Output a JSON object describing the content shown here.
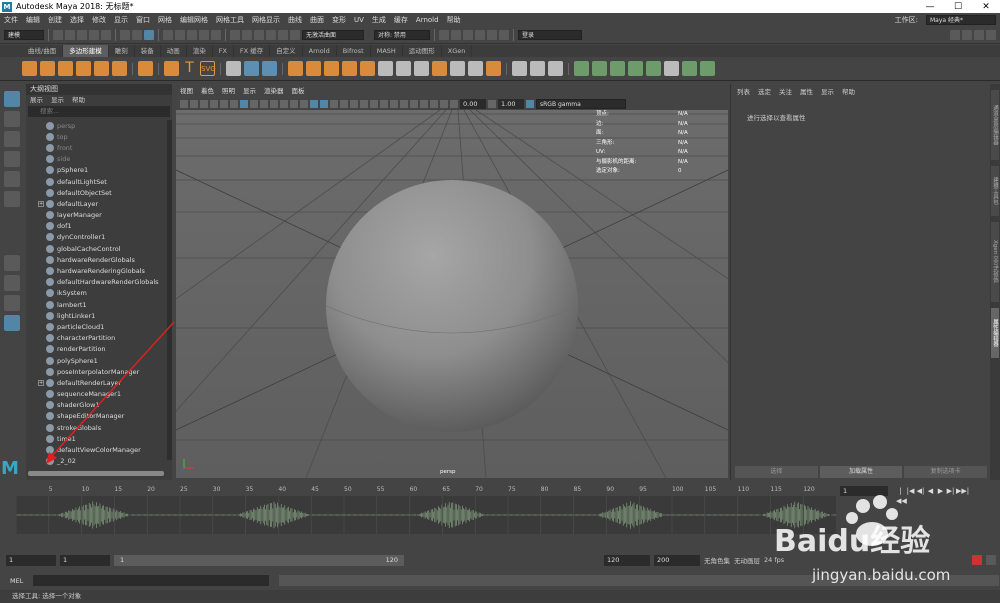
{
  "window": {
    "title": "Autodesk Maya 2018: 无标题*",
    "controls": [
      "—",
      "☐",
      "✕"
    ]
  },
  "menubar": {
    "items": [
      "文件",
      "编辑",
      "创建",
      "选择",
      "修改",
      "显示",
      "窗口",
      "网格",
      "编辑网格",
      "网格工具",
      "网格显示",
      "曲线",
      "曲面",
      "变形",
      "UV",
      "生成",
      "缓存",
      "Arnold",
      "帮助"
    ],
    "workspace_label": "工作区:",
    "workspace_value": "Maya 经典*"
  },
  "statusline": {
    "mode": "建模",
    "object_field": "无激活曲面",
    "symmetry": "对称: 禁用",
    "login": "登录"
  },
  "shelf": {
    "tabs": [
      "曲线/曲面",
      "多边形建模",
      "雕刻",
      "装备",
      "动画",
      "渲染",
      "FX",
      "FX 缓存",
      "自定义",
      "Arnold",
      "Bifrost",
      "MASH",
      "运动图形",
      "XGen"
    ],
    "active_tab": 1,
    "text_tool": "T",
    "svg_tool": "SVG"
  },
  "outliner": {
    "title": "大纲视图",
    "menu": [
      "展示",
      "显示",
      "帮助"
    ],
    "search_placeholder": "搜索...",
    "items": [
      {
        "label": "persp",
        "dim": true
      },
      {
        "label": "top",
        "dim": true
      },
      {
        "label": "front",
        "dim": true
      },
      {
        "label": "side",
        "dim": true
      },
      {
        "label": "pSphere1",
        "dim": false
      },
      {
        "label": "defaultLightSet",
        "dim": false
      },
      {
        "label": "defaultObjectSet",
        "dim": false
      },
      {
        "label": "defaultLayer",
        "dim": false,
        "expand": true
      },
      {
        "label": "layerManager",
        "dim": false
      },
      {
        "label": "dof1",
        "dim": false
      },
      {
        "label": "dynController1",
        "dim": false
      },
      {
        "label": "globalCacheControl",
        "dim": false
      },
      {
        "label": "hardwareRenderGlobals",
        "dim": false
      },
      {
        "label": "hardwareRenderingGlobals",
        "dim": false
      },
      {
        "label": "defaultHardwareRenderGlobals",
        "dim": false
      },
      {
        "label": "ikSystem",
        "dim": false
      },
      {
        "label": "lambert1",
        "dim": false
      },
      {
        "label": "lightLinker1",
        "dim": false
      },
      {
        "label": "particleCloud1",
        "dim": false
      },
      {
        "label": "characterPartition",
        "dim": false
      },
      {
        "label": "renderPartition",
        "dim": false
      },
      {
        "label": "polySphere1",
        "dim": false
      },
      {
        "label": "poseInterpolatorManager",
        "dim": false
      },
      {
        "label": "defaultRenderLayer",
        "dim": false,
        "expand": true
      },
      {
        "label": "sequenceManager1",
        "dim": false
      },
      {
        "label": "shaderGlow1",
        "dim": false
      },
      {
        "label": "shapeEditorManager",
        "dim": false
      },
      {
        "label": "strokeGlobals",
        "dim": false
      },
      {
        "label": "time1",
        "dim": false
      },
      {
        "label": "defaultViewColorManager",
        "dim": false
      },
      {
        "label": "_2_02",
        "dim": false
      }
    ]
  },
  "viewport": {
    "menu": [
      "视图",
      "着色",
      "照明",
      "显示",
      "渲染器",
      "面板"
    ],
    "exposure": "0.00",
    "gamma": "1.00",
    "color_space": "sRGB gamma",
    "hud": [
      {
        "label": "顶点:",
        "value": "N/A"
      },
      {
        "label": "边:",
        "value": "N/A"
      },
      {
        "label": "面:",
        "value": "N/A"
      },
      {
        "label": "三角形:",
        "value": "N/A"
      },
      {
        "label": "UV:",
        "value": "N/A"
      },
      {
        "label": "与摄影机的距离:",
        "value": "N/A"
      },
      {
        "label": "选定对象:",
        "value": "0"
      }
    ],
    "camera": "persp"
  },
  "attribute_editor": {
    "menu": [
      "列表",
      "选定",
      "关注",
      "属性",
      "显示",
      "帮助"
    ],
    "message": "进行选择以查看属性",
    "buttons": [
      "选择",
      "加载属性",
      "复制选项卡"
    ],
    "side_tabs": [
      "通道盒/层编辑器",
      "建模工具包",
      "Xgen 交互式修饰",
      "属性编辑器"
    ]
  },
  "timeslider": {
    "tick_labels": [
      "5",
      "10",
      "15",
      "20",
      "25",
      "30",
      "35",
      "40",
      "45",
      "50",
      "55",
      "60",
      "65",
      "70",
      "75",
      "80",
      "85",
      "90",
      "95",
      "100",
      "105",
      "110",
      "115",
      "120"
    ],
    "current_frame": "1",
    "playback_buttons": [
      "|◀◀",
      "|◀",
      "◀|",
      "◀",
      "▶",
      "▶|",
      "▶▶|"
    ]
  },
  "rangebar": {
    "start": "1",
    "playback_start": "1",
    "range_left": "1",
    "range_right": "120",
    "playback_end": "120",
    "end": "200",
    "character": "无角色集",
    "anim_layer": "无动画层",
    "fps": "24 fps"
  },
  "mel": {
    "label": "MEL"
  },
  "help_line": "选择工具: 选择一个对象",
  "watermark": {
    "brand": "Baidu经验",
    "url": "jingyan.baidu.com"
  }
}
